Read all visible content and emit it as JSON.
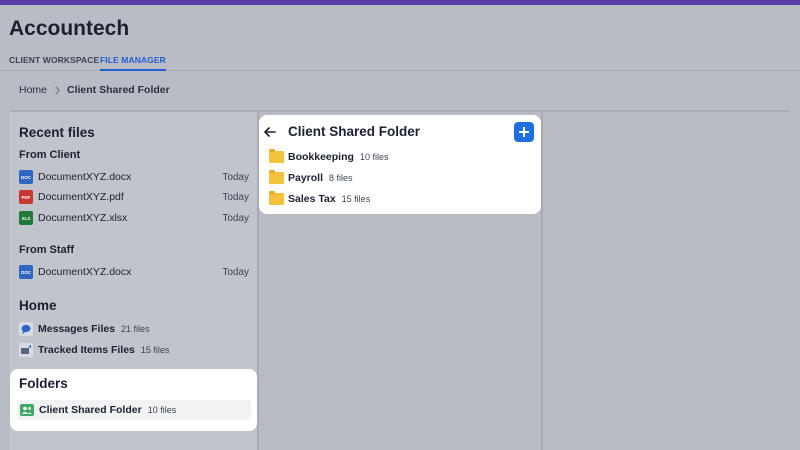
{
  "app": {
    "title": "Accountech"
  },
  "tabs": [
    {
      "label": "CLIENT WORKSPACE",
      "active": false
    },
    {
      "label": "FILE MANAGER",
      "active": true
    }
  ],
  "breadcrumb": {
    "home": "Home",
    "current": "Client Shared Folder"
  },
  "sidebar": {
    "recent_title": "Recent files",
    "from_client_title": "From Client",
    "from_client_files": [
      {
        "icon": "DOC",
        "name": "DocumentXYZ.docx",
        "date": "Today"
      },
      {
        "icon": "PDF",
        "name": "DocumentXYZ.pdf",
        "date": "Today"
      },
      {
        "icon": "XLS",
        "name": "DocumentXYZ.xlsx",
        "date": "Today"
      }
    ],
    "from_staff_title": "From Staff",
    "from_staff_files": [
      {
        "icon": "DOC",
        "name": "DocumentXYZ.docx",
        "date": "Today"
      }
    ],
    "home_title": "Home",
    "home_items": [
      {
        "name": "Messages Files",
        "count": "21 files"
      },
      {
        "name": "Tracked Items Files",
        "count": "15 files"
      }
    ],
    "folders_title": "Folders",
    "folders": [
      {
        "name": "Client Shared Folder",
        "count": "10 files"
      }
    ]
  },
  "folder_panel": {
    "title": "Client Shared Folder",
    "items": [
      {
        "name": "Bookkeeping",
        "count": "10 files"
      },
      {
        "name": "Payroll",
        "count": "8 files"
      },
      {
        "name": "Sales Tax",
        "count": "15 files"
      }
    ]
  },
  "colors": {
    "accent": "#1f5fd1",
    "topbar": "#5b3fa8",
    "folder": "#f3c23c",
    "overlay": "#b9bcc4"
  }
}
